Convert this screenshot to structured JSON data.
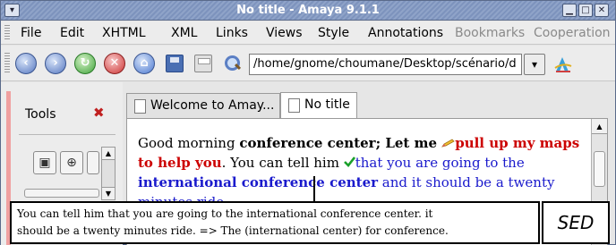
{
  "window": {
    "title": "No title - Amaya 9.1.1",
    "sysmenu_icon": "chevron-down-icon",
    "controls": [
      "minimize-icon",
      "maximize-icon",
      "close-icon"
    ]
  },
  "menubar": {
    "items": [
      "File",
      "Edit",
      "XHTML",
      "XML",
      "Links",
      "Views",
      "Style",
      "Annotations",
      "Bookmarks",
      "Cooperation"
    ],
    "disabled": [
      "Bookmarks",
      "Cooperation"
    ]
  },
  "toolbar": {
    "buttons": [
      "back-icon",
      "forward-icon",
      "reload-icon",
      "stop-icon",
      "home-icon",
      "save-icon",
      "print-icon",
      "find-icon"
    ],
    "url": "/home/gnome/choumane/Desktop/scénario/d",
    "dropdown_icon": "chevron-down-icon",
    "logo_icon": "amaya-icon"
  },
  "tools_panel": {
    "label": "Tools",
    "close_icon": "close-icon"
  },
  "tabs": [
    {
      "label": "Welcome to Amay...",
      "active": false
    },
    {
      "label": "No title",
      "active": true
    }
  ],
  "document": {
    "segments": {
      "s1": "Good morning ",
      "s2": "conference center; Let me ",
      "s3": "pull up my maps to help you",
      "s4": ". You can tell him ",
      "s5": "that you are going to the ",
      "s6": "international conference center",
      "s7": " and it should be a twenty minutes ride."
    }
  },
  "caption": {
    "line1": "You can tell him that you are going to the international conference center. it",
    "line2": "should be a twenty minutes ride. => The (international center) for conference."
  },
  "badge": {
    "label": "SED"
  },
  "colors": {
    "titlebar": "#7d93bd",
    "red_text": "#cc0000",
    "blue_text": "#1a1acc"
  }
}
